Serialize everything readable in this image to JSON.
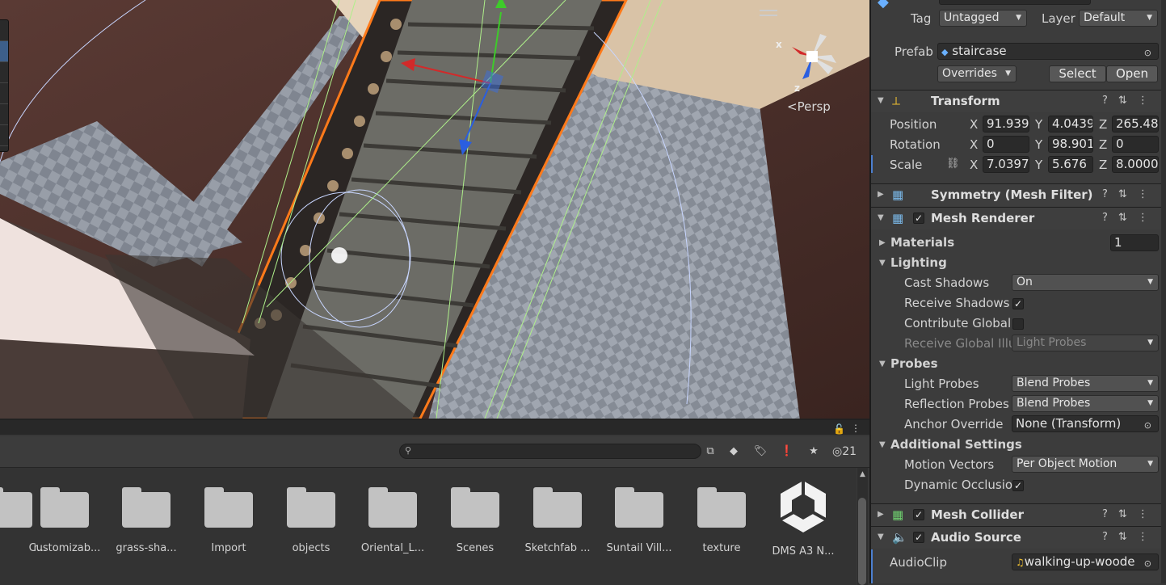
{
  "scene": {
    "camera_label": "Persp",
    "gizmo_axes": {
      "x": "x",
      "z": "z"
    }
  },
  "project": {
    "search": {
      "value": "",
      "placeholder": ""
    },
    "toolbar_icons": [
      "scene-search-icon",
      "type-filter-icon",
      "label-filter-icon",
      "warning-filter-icon",
      "favorite-star-icon"
    ],
    "hidden_count": "21",
    "assets": [
      {
        "name": "r...",
        "type": "folder"
      },
      {
        "name": "Customizab...",
        "type": "folder"
      },
      {
        "name": "grass-sha...",
        "type": "folder"
      },
      {
        "name": "Import",
        "type": "folder"
      },
      {
        "name": "objects",
        "type": "folder"
      },
      {
        "name": "Oriental_L...",
        "type": "folder"
      },
      {
        "name": "Scenes",
        "type": "folder"
      },
      {
        "name": "Sketchfab ...",
        "type": "folder"
      },
      {
        "name": "Suntail Vill...",
        "type": "folder"
      },
      {
        "name": "texture",
        "type": "folder"
      },
      {
        "name": "DMS A3 N...",
        "type": "unity-package"
      }
    ]
  },
  "inspector": {
    "tag_label": "Tag",
    "tag_value": "Untagged",
    "layer_label": "Layer",
    "layer_value": "Default",
    "prefab_label": "Prefab",
    "prefab_value": "staircase",
    "overrides_label": "Overrides",
    "select_label": "Select",
    "open_label": "Open",
    "transform": {
      "title": "Transform",
      "position_label": "Position",
      "rotation_label": "Rotation",
      "scale_label": "Scale",
      "position": {
        "x": "91.939",
        "y": "4.0439",
        "z": "265.48"
      },
      "rotation": {
        "x": "0",
        "y": "98.901",
        "z": "0"
      },
      "scale": {
        "x": "7.0397",
        "y": "5.676",
        "z": "8.0000"
      },
      "axis_x": "X",
      "axis_y": "Y",
      "axis_z": "Z"
    },
    "mesh_filter_title": "Symmetry (Mesh Filter)",
    "mesh_renderer": {
      "title": "Mesh Renderer",
      "enabled": true,
      "materials_label": "Materials",
      "materials_count": "1",
      "lighting_label": "Lighting",
      "cast_shadows_label": "Cast Shadows",
      "cast_shadows_value": "On",
      "receive_shadows_label": "Receive Shadows",
      "receive_shadows": true,
      "contribute_gi_label": "Contribute Global",
      "contribute_gi": false,
      "receive_gi_label": "Receive Global Illu",
      "receive_gi_value": "Light Probes",
      "probes_label": "Probes",
      "light_probes_label": "Light Probes",
      "light_probes_value": "Blend Probes",
      "reflection_probes_label": "Reflection Probes",
      "reflection_probes_value": "Blend Probes",
      "anchor_override_label": "Anchor Override",
      "anchor_override_value": "None (Transform)",
      "additional_label": "Additional Settings",
      "motion_vectors_label": "Motion Vectors",
      "motion_vectors_value": "Per Object Motion",
      "dynamic_occlusion_label": "Dynamic Occlusio",
      "dynamic_occlusion": true
    },
    "mesh_collider_title": "Mesh Collider",
    "audio_source": {
      "title": "Audio Source",
      "audioclip_label": "AudioClip",
      "audioclip_value": "walking-up-woode"
    }
  },
  "colors": {
    "accent_selection": "#ff7a1a",
    "gizmo_x": "#d22a2a",
    "gizmo_y": "#3ecb2a",
    "gizmo_z": "#2a5ee0"
  }
}
